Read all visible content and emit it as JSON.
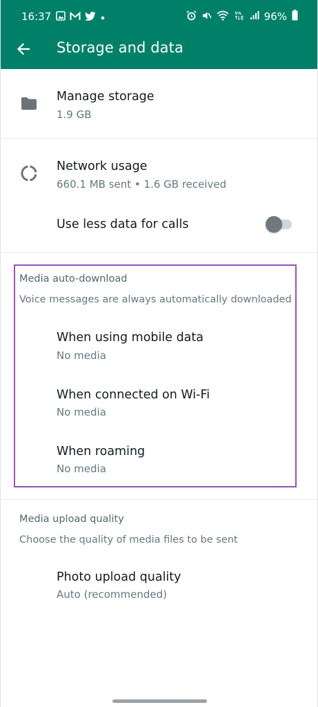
{
  "status_bar": {
    "time": "16:37",
    "battery": "96%",
    "left_icons": [
      "gallery-icon",
      "gmail-icon",
      "twitter-icon",
      "dot-icon"
    ],
    "right_icons": [
      "alarm-icon",
      "mute-icon",
      "wifi-icon",
      "volte-icon",
      "signal-icon",
      "battery-icon"
    ]
  },
  "header": {
    "title": "Storage and data",
    "back_icon": "arrow-back-icon",
    "color": "#008069"
  },
  "items": {
    "manage_storage": {
      "title": "Manage storage",
      "subtitle": "1.9 GB",
      "icon": "folder-icon"
    },
    "network_usage": {
      "title": "Network usage",
      "subtitle": "660.1 MB sent • 1.6 GB received",
      "icon": "data-usage-icon"
    },
    "less_data": {
      "title": "Use less data for calls",
      "toggle_on": false
    }
  },
  "media_auto_download": {
    "title": "Media auto-download",
    "description": "Voice messages are always automatically downloaded",
    "options": [
      {
        "title": "When using mobile data",
        "value": "No media"
      },
      {
        "title": "When connected on Wi-Fi",
        "value": "No media"
      },
      {
        "title": "When roaming",
        "value": "No media"
      }
    ],
    "highlight_color": "#9b4fb0"
  },
  "media_upload_quality": {
    "title": "Media upload quality",
    "description": "Choose the quality of media files to be sent",
    "photo": {
      "title": "Photo upload quality",
      "value": "Auto (recommended)"
    }
  }
}
